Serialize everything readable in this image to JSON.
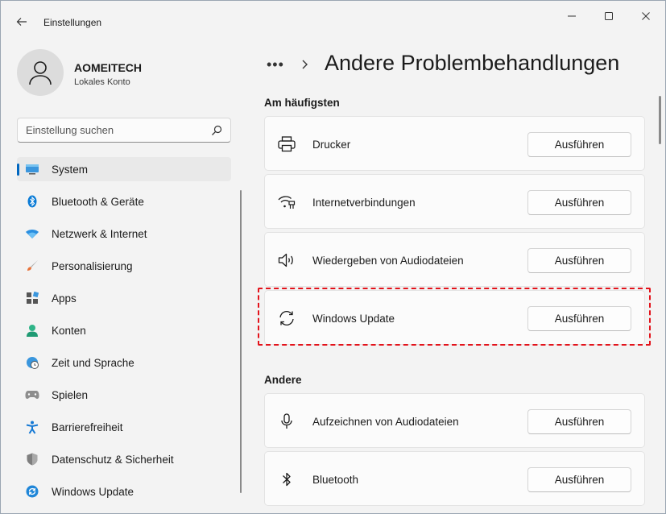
{
  "window": {
    "app_title": "Einstellungen",
    "back_icon": "back-arrow-icon",
    "controls": [
      "minimize-icon",
      "maximize-icon",
      "close-icon"
    ]
  },
  "profile": {
    "name": "AOMEITECH",
    "subtitle": "Lokales Konto",
    "avatar_icon": "person-icon"
  },
  "search": {
    "placeholder": "Einstellung suchen",
    "value": "",
    "icon": "search-icon"
  },
  "sidebar": {
    "accent_color": "#0067c0",
    "active_index": 0,
    "items": [
      {
        "label": "System",
        "icon": "monitor-icon"
      },
      {
        "label": "Bluetooth & Geräte",
        "icon": "bluetooth-icon"
      },
      {
        "label": "Netzwerk & Internet",
        "icon": "wifi-icon"
      },
      {
        "label": "Personalisierung",
        "icon": "brush-icon"
      },
      {
        "label": "Apps",
        "icon": "apps-icon"
      },
      {
        "label": "Konten",
        "icon": "account-icon"
      },
      {
        "label": "Zeit und Sprache",
        "icon": "globe-clock-icon"
      },
      {
        "label": "Spielen",
        "icon": "gamepad-icon"
      },
      {
        "label": "Barrierefreiheit",
        "icon": "accessibility-icon"
      },
      {
        "label": "Datenschutz & Sicherheit",
        "icon": "shield-icon"
      },
      {
        "label": "Windows Update",
        "icon": "update-icon"
      }
    ]
  },
  "main": {
    "breadcrumb_more": "•••",
    "page_title": "Andere Problembehandlungen",
    "highlight_color": "#e3131b",
    "sections": [
      {
        "title": "Am häufigsten",
        "items": [
          {
            "label": "Drucker",
            "icon": "printer-icon",
            "button": "Ausführen"
          },
          {
            "label": "Internetverbindungen",
            "icon": "wifi-icon",
            "button": "Ausführen"
          },
          {
            "label": "Wiedergeben von Audiodateien",
            "icon": "speaker-icon",
            "button": "Ausführen"
          },
          {
            "label": "Windows Update",
            "icon": "refresh-icon",
            "button": "Ausführen"
          }
        ]
      },
      {
        "title": "Andere",
        "items": [
          {
            "label": "Aufzeichnen von Audiodateien",
            "icon": "microphone-icon",
            "button": "Ausführen"
          },
          {
            "label": "Bluetooth",
            "icon": "bluetooth-icon",
            "button": "Ausführen"
          }
        ]
      }
    ]
  }
}
